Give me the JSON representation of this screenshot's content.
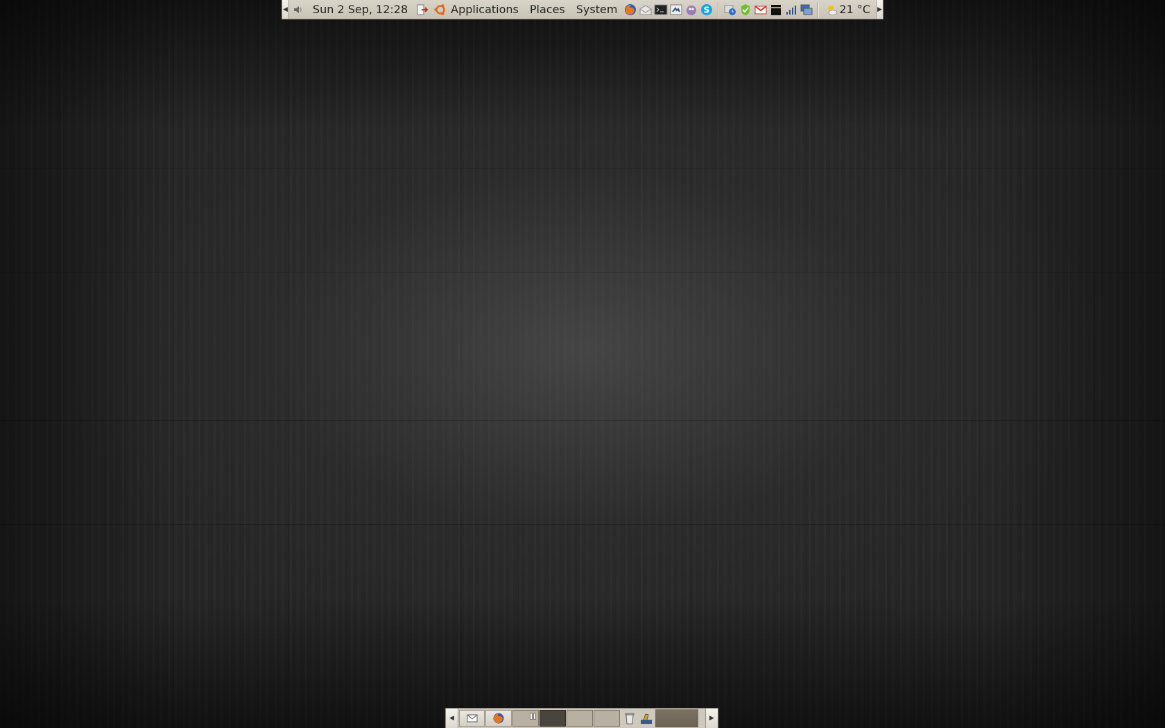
{
  "top_panel": {
    "clock": "Sun  2 Sep, 12:28",
    "menus": {
      "applications": "Applications",
      "places": "Places",
      "system": "System"
    },
    "launchers": [
      "firefox-icon",
      "mail-client-icon",
      "terminal-icon",
      "network-icon",
      "pidgin-icon",
      "skype-icon"
    ],
    "tray": [
      "notification-icon",
      "update-icon",
      "gmail-icon",
      "kaaba-icon",
      "signal-bars-icon",
      "network-monitor-icon"
    ],
    "weather": "21 °C"
  },
  "bottom_panel": {
    "task_icons": [
      "mail-icon",
      "firefox-icon"
    ],
    "workspaces": [
      "workspace-1",
      "workspace-2",
      "workspace-3",
      "workspace-4"
    ],
    "active_workspace": "workspace-2",
    "tray": [
      "trash-icon",
      "scanner-icon"
    ]
  },
  "colors": {
    "panel": "#cfc9bd",
    "active_workspace": "#4a443e",
    "wallpaper": "#262626"
  }
}
